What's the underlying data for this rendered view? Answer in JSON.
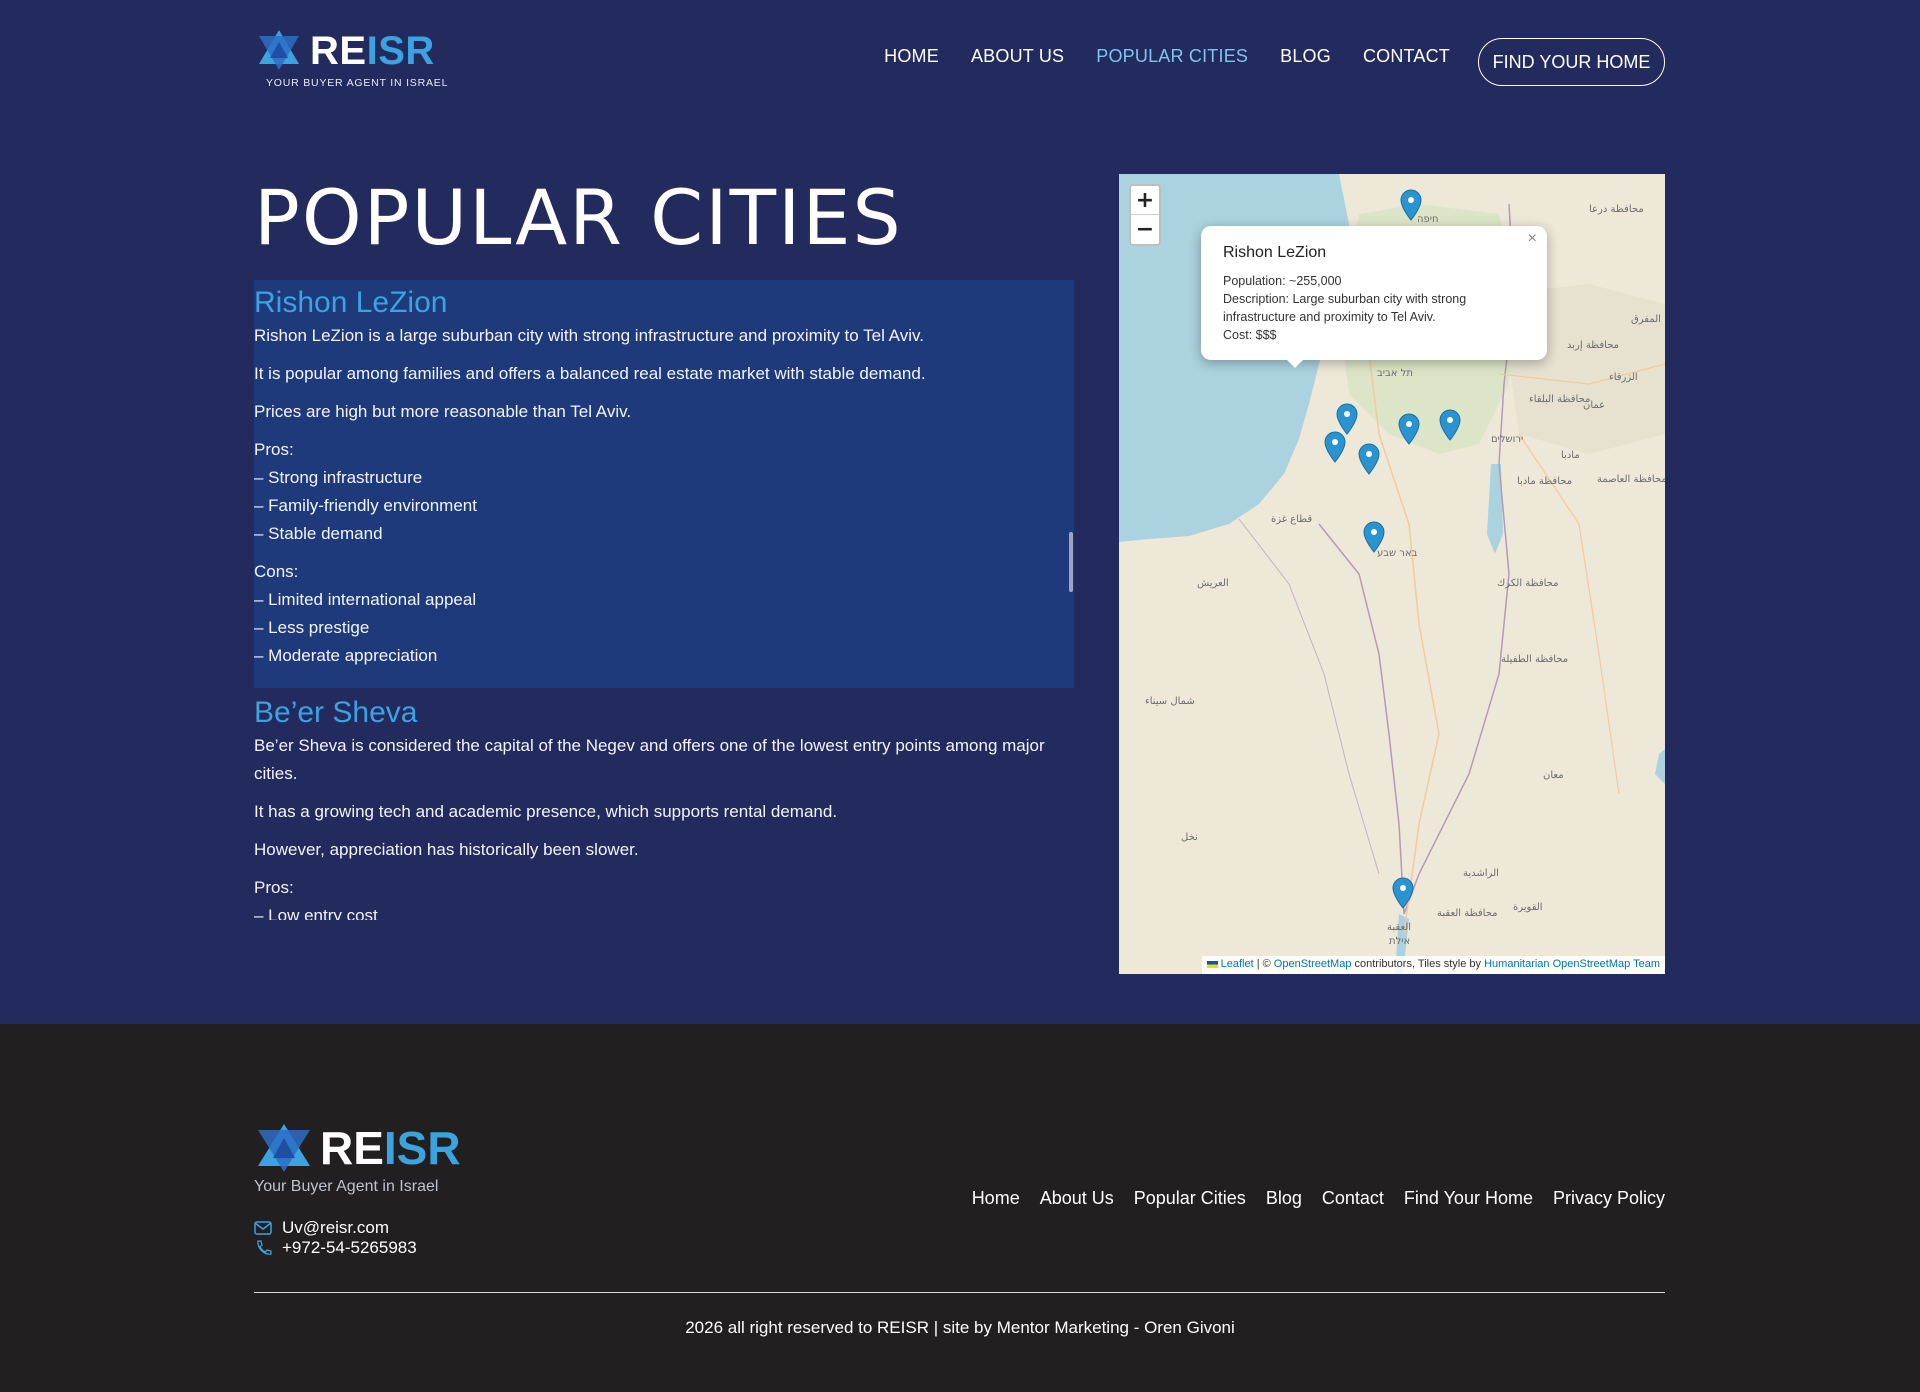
{
  "brand": {
    "name_part1": "RE",
    "name_part2": "ISR",
    "tagline": "YOUR BUYER AGENT IN ISRAEL",
    "footer_tagline": "Your Buyer Agent in Israel",
    "accent": "#3aa3e0"
  },
  "nav": {
    "items": [
      {
        "label": "HOME"
      },
      {
        "label": "ABOUT US"
      },
      {
        "label": "POPULAR CITIES"
      },
      {
        "label": "BLOG"
      },
      {
        "label": "CONTACT"
      }
    ],
    "cta_label": "FIND YOUR HOME"
  },
  "page": {
    "title": "POPULAR CITIES"
  },
  "cities": [
    {
      "name": "Rishon LeZion",
      "paragraphs": [
        "Rishon LeZion is a large suburban city with strong infrastructure and proximity to Tel Aviv.",
        "It is popular among families and offers a balanced real estate market with stable demand.",
        "Prices are high but more reasonable than Tel Aviv."
      ],
      "pros_label": "Pros:",
      "pros": [
        "– Strong infrastructure",
        "– Family-friendly environment",
        "– Stable demand"
      ],
      "cons_label": "Cons:",
      "cons": [
        "– Limited international appeal",
        "– Less prestige",
        "– Moderate appreciation"
      ]
    },
    {
      "name": "Be’er Sheva",
      "paragraphs": [
        "Be’er Sheva is considered the capital of the Negev and offers one of the lowest entry points among major cities.",
        "It has a growing tech and academic presence, which supports rental demand.",
        "However, appreciation has historically been slower."
      ],
      "pros_label": "Pros:",
      "pros": [
        "– Low entry cost"
      ]
    }
  ],
  "map": {
    "zoom_in": "+",
    "zoom_out": "−",
    "popup": {
      "title": "Rishon LeZion",
      "population": "Population: ~255,000",
      "description": "Description: Large suburban city with strong infrastructure and proximity to Tel Aviv.",
      "cost": "Cost: $$$",
      "close": "×"
    },
    "attribution": {
      "leaflet": "Leaflet",
      "sep1": " | © ",
      "osm": "OpenStreetMap",
      "mid": " contributors, Tiles style by ",
      "hot": "Humanitarian OpenStreetMap Team"
    },
    "labels": {
      "haifa": "חיפה",
      "tel_aviv": "תל אביב",
      "jerusalem": "ירושלים",
      "beer_sheva": "באר שבע",
      "eilat": "אילת",
      "amman": "عمان",
      "madaba": "مادبا",
      "gaza": "قطاع غزة",
      "arish": "العريش",
      "north_sinai": "شمال سيناء",
      "karak": "محافظة الكرك",
      "tafilah": "محافظة الطفيلة",
      "maan": "معان",
      "nakhl": "نخل",
      "rashidiya": "الراشدية",
      "aqaba": "محافظة العقبة",
      "mafraq": "المفرق",
      "zarqa": "الزرقاء",
      "irbid": "محافظة إربد",
      "deraa": "محافظة درعا",
      "balqa": "محافظة البلقاء",
      "capital": "محافظة العاصمة",
      "madaba_gov": "محافظة مادبا",
      "quwaira": "القويرة",
      "eilat2": "العقبة"
    },
    "colors": {
      "sea": "#aad3df",
      "land": "#eee8d8",
      "marker": "#2a93d0"
    }
  },
  "footer": {
    "email": "Uv@reisr.com",
    "phone": "+972-54-5265983",
    "links": [
      {
        "label": "Home"
      },
      {
        "label": "About Us"
      },
      {
        "label": "Popular Cities"
      },
      {
        "label": "Blog"
      },
      {
        "label": "Contact"
      },
      {
        "label": "Find Your Home"
      },
      {
        "label": "Privacy Policy"
      }
    ],
    "copyright": "2026 all right reserved to REISR | site by Mentor Marketing - Oren Givoni"
  }
}
